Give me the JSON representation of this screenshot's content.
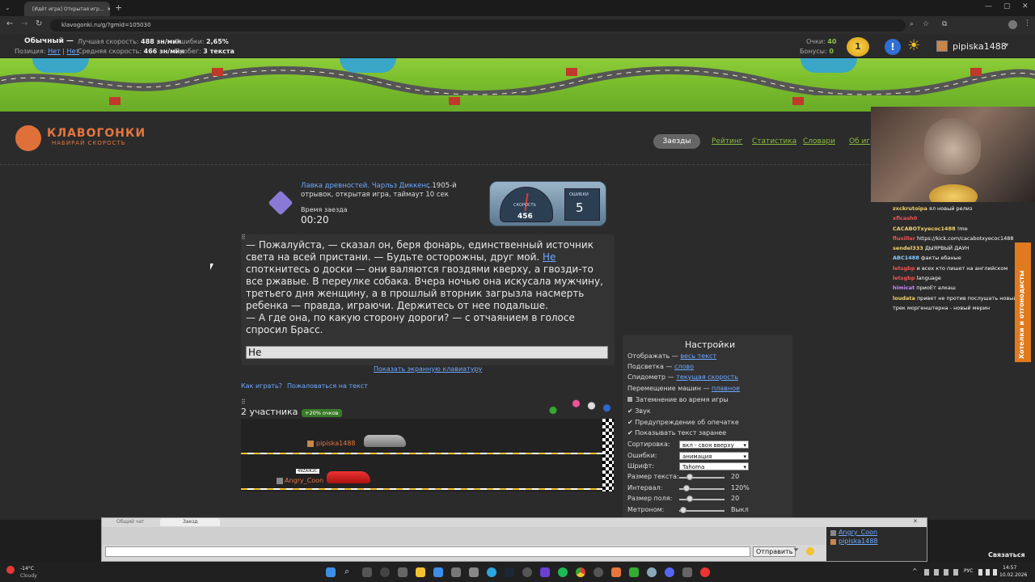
{
  "browser": {
    "tab_title": "[Идёт игра] Открытая игр...",
    "url": "klavogonki.ru/g/?gmid=105030"
  },
  "statbar": {
    "mode": "Обычный —",
    "position_label": "Позиция:",
    "position_value1": "Нет",
    "position_value2": "Нет",
    "best_speed_label": "Лучшая скорость:",
    "best_speed_value": "488 зн/мин",
    "avg_speed_label": "Средняя скорость:",
    "avg_speed_value": "466 зн/мин",
    "errors_label": "Ошибки:",
    "errors_value": "2,65%",
    "mileage_label": "Пробег:",
    "mileage_value": "3 текста",
    "points_label": "Очки:",
    "points_value": "40",
    "bonus_label": "Бонусы:",
    "bonus_value": "0",
    "level_badge": "1",
    "username": "pipiska1488"
  },
  "site": {
    "logo_title": "КЛАВОГОНКИ",
    "logo_subtitle": "НАБИРАЙ СКОРОСТЬ",
    "nav": [
      "Заезды",
      "Рейтинг",
      "Статистика",
      "Словари",
      "Об игр"
    ]
  },
  "game": {
    "source_title": "Лавка древностей. Чарльз Диккенс.",
    "source_rest": ", 1905-й",
    "source_line2": "отрывок, открытая игра, таймаут 10 сек",
    "race_time_label": "Время заезда",
    "race_time": "00:20",
    "speed_label": "СКОРОСТЬ",
    "speed_value": "456",
    "errors_label": "ОШИБКИ",
    "errors_value": "5",
    "text_before": "— Пожалуйста, — сказал он, беря фонарь, единственный источник света на всей пристани. — Будьте осторожны, друг мой. ",
    "text_current": "Не",
    "text_after": " споткнитесь о доски — они валяются гвоздями кверху, а гвозди-то все ржавые. В переулке собака. Вчера ночью она искусала мужчину, третьего дня женщину, а в прошлый вторник загрызла насмерть ребенка — правда, играючи. Держитесь от нее подальше.",
    "text_line2": "— А где она, по какую сторону дороги? — с отчаянием в голосе спросил Брасс.",
    "input_value": "Не",
    "keyboard_link": "Показать экранную клавиатуру",
    "how_to_play": "Как играть?",
    "complain": "Пожаловаться на текст",
    "participants": "2 участника",
    "bonus_badge": "+20% очков",
    "racer1": "pipiska1488",
    "racer2": "Angry_Coon",
    "racer2_plate": "49ZAIK2C"
  },
  "settings": {
    "title": "Настройки",
    "display_label": "Отображать —",
    "display_value": "весь текст",
    "highlight_label": "Подсветка —",
    "highlight_value": "слово",
    "speedometer_label": "Спидометр —",
    "speedometer_value": "текущая скорость",
    "car_move_label": "Перемещение машин —",
    "car_move_value": "плавное",
    "dim": "Затемнение во время игры",
    "sound": "Звук",
    "typo_warning": "Предупреждение об опечатке",
    "show_text": "Показывать текст заранее",
    "sort_label": "Сортировка:",
    "sort_value": "вкл - своя вверху",
    "errors_label": "Ошибки:",
    "errors_value": "анимация",
    "font_label": "Шрифт:",
    "font_value": "Tahoma",
    "text_size_label": "Размер текста:",
    "text_size_value": "20",
    "interval_label": "Интервал:",
    "interval_value": "120%",
    "field_size_label": "Размер поля:",
    "field_size_value": "20",
    "metronome_label": "Метроном:",
    "metronome_value": "Выкл"
  },
  "stream_chat": [
    {
      "user": "zxckrutoipa",
      "msg": "ял новый релиз"
    },
    {
      "user": "xflcash0",
      "msg": ""
    },
    {
      "user": "CACABOTxyecoc1488",
      "msg": "!me"
    },
    {
      "user": "fluxiller",
      "msg": "https://kick.com/cacabotxyecoc1488"
    },
    {
      "user": "sendel333",
      "msg": "ДЫЯРВЫЙ ДАУН"
    },
    {
      "user": "ABC1488",
      "msg": "факты ебаные"
    },
    {
      "user": "letsgbp",
      "msg": "и всех кто пишет на английском"
    },
    {
      "user": "letsgbp",
      "msg": "language"
    },
    {
      "user": "himicat",
      "msg": "приоЕт алкаш"
    },
    {
      "user": "loudata",
      "msg": "привет не против послушать новый"
    },
    {
      "user": "",
      "msg": "трек моргенштерна - новый мерин"
    }
  ],
  "stream_side_tab": "Хотелки и отгонодисты",
  "chat_panel": {
    "tab1": "Общий чат",
    "tab2": "Заезд",
    "send_button": "Отправить",
    "user1": "Angry_Coon",
    "user2": "pipiska1488"
  },
  "taskbar": {
    "weather_temp": "-14°C",
    "weather_desc": "Cloudy",
    "lang": "РУС",
    "time": "14:57",
    "date": "10.02.2026",
    "connect": "Связаться"
  }
}
